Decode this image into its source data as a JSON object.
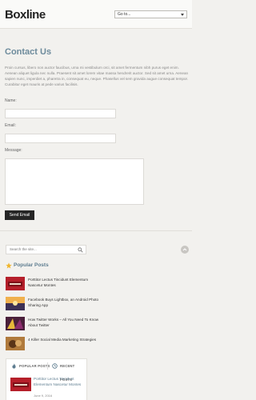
{
  "header": {
    "logo": "Boxline",
    "nav_select": "Go to..."
  },
  "page": {
    "title": "Contact Us",
    "intro": "Proin cursus, libero non auctor faucibus, urna mi vestibulum orci, sit amet fermentum nibh purus eget enim. Aenean aliquet ligula nec nulla. Praesent sit amet lorem vitae massa hendrerit auctor. Sed sit amet urna. Aenean sapien nunc, imperdiet a, pharetra in, consequat eu, neque. Phasellus vel sem gravida augue consequat tempor. Curabitur eget mauris at pede varius facilisis."
  },
  "form": {
    "name_label": "Name:",
    "email_label": "Email:",
    "message_label": "Message:",
    "send_label": "Send Email"
  },
  "sidebar": {
    "search_placeholder": "Search the site...",
    "popular_title": "Popular Posts",
    "popular_posts": [
      {
        "title": "Porttitor Lectus Tincidunt Elementum Nascetur Montes"
      },
      {
        "title": "Facebook Buys Lightbox, an Android Photo Sharing App"
      },
      {
        "title": "How Twitter Works – All You Need To Know About Twitter"
      },
      {
        "title": "4 Killer Social Media Marketing Strategies"
      }
    ],
    "tabs": {
      "popular_label": "POPULAR POSTS",
      "recent_label": "RECENT POSTS",
      "recent_title": "Porttitor Lectus Tincidunt Elementum Nascetur Montes",
      "recent_date": "June 9, 2016"
    }
  },
  "colors": {
    "accent": "#6d8b9c",
    "button": "#262626",
    "background": "#f2f1ee"
  }
}
